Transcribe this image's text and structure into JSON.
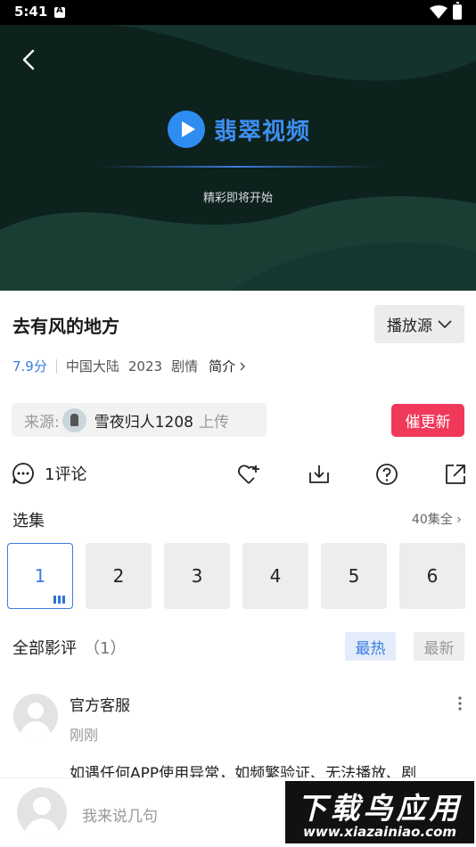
{
  "status_bar": {
    "time": "5:41"
  },
  "player": {
    "brand_name": "翡翠视频",
    "loading_text": "精彩即将开始"
  },
  "show": {
    "title": "去有风的地方",
    "source_button": "播放源",
    "score": "7.9分",
    "region": "中国大陆",
    "year": "2023",
    "genre": "剧情",
    "intro_label": "简介",
    "uploader_label": "来源:",
    "uploader_name": "雪夜归人1208",
    "uploader_action": "上传",
    "urge_button": "催更新"
  },
  "actions": {
    "comment_count": "1评论"
  },
  "episodes": {
    "title": "选集",
    "total_label": "40集全",
    "items": [
      "1",
      "2",
      "3",
      "4",
      "5",
      "6"
    ],
    "active_index": 0
  },
  "reviews": {
    "title": "全部影评",
    "count": "（1）",
    "tab_hot": "最热",
    "tab_new": "最新",
    "items": [
      {
        "author": "官方客服",
        "time": "刚刚",
        "body": "如遇任何APP使用异常，如频繁验证、无法播放、剧"
      }
    ]
  },
  "composer": {
    "placeholder": "我来说几句"
  },
  "watermark": {
    "title": "下载鸟应用",
    "url": "www.xiazainiao.com"
  },
  "colors": {
    "accent": "#3a7de0",
    "urge": "#f0395a",
    "player_bg": "#0f2521"
  }
}
